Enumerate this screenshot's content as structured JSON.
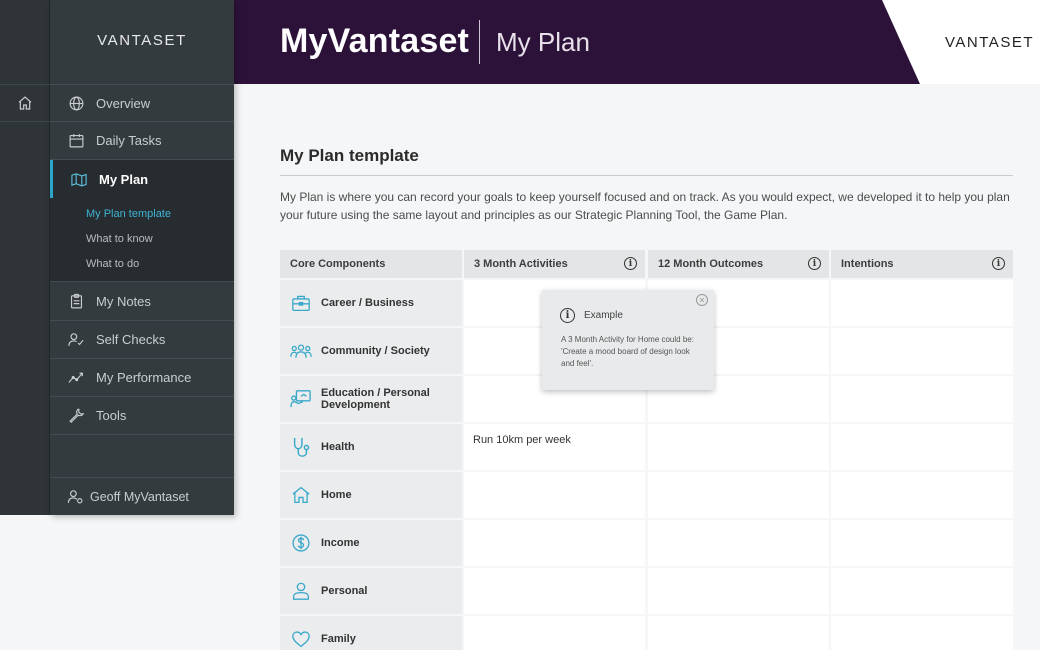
{
  "header": {
    "title": "MyVantaset",
    "subtitle": "My Plan",
    "logo_right": "VANTASET"
  },
  "sidebar": {
    "logo": "VANTASET",
    "items": [
      {
        "label": "Overview",
        "icon": "globe-icon"
      },
      {
        "label": "Daily Tasks",
        "icon": "calendar-icon"
      },
      {
        "label": "My Plan",
        "icon": "map-icon"
      },
      {
        "label": "My Notes",
        "icon": "clipboard-icon"
      },
      {
        "label": "Self Checks",
        "icon": "user-check-icon"
      },
      {
        "label": "My Performance",
        "icon": "trend-icon"
      },
      {
        "label": "Tools",
        "icon": "wrench-icon"
      }
    ],
    "subitems": [
      {
        "label": "My Plan template"
      },
      {
        "label": "What to know"
      },
      {
        "label": "What to do"
      }
    ],
    "user": "Geoff MyVantaset"
  },
  "main": {
    "title": "My Plan template",
    "intro": "My Plan is where you can record your goals to keep yourself focused and on track. As you would expect, we developed it to help you plan your future using the same layout and principles as our Strategic Planning Tool, the Game Plan."
  },
  "table": {
    "columns": [
      "Core Components",
      "3 Month Activities",
      "12 Month Outcomes",
      "Intentions"
    ],
    "rows": [
      {
        "label": "Career / Business",
        "icon": "briefcase-icon",
        "values": [
          "",
          "",
          ""
        ]
      },
      {
        "label": "Community / Society",
        "icon": "people-icon",
        "values": [
          "",
          "",
          ""
        ]
      },
      {
        "label": "Education / Personal Development",
        "icon": "presentation-icon",
        "values": [
          "",
          "",
          ""
        ]
      },
      {
        "label": "Health",
        "icon": "stethoscope-icon",
        "values": [
          "Run 10km per week",
          "",
          ""
        ]
      },
      {
        "label": "Home",
        "icon": "home-icon",
        "values": [
          "",
          "",
          ""
        ]
      },
      {
        "label": "Income",
        "icon": "dollar-icon",
        "values": [
          "",
          "",
          ""
        ]
      },
      {
        "label": "Personal",
        "icon": "person-icon",
        "values": [
          "",
          "",
          ""
        ]
      },
      {
        "label": "Family",
        "icon": "heart-icon",
        "values": [
          "",
          "",
          ""
        ]
      }
    ]
  },
  "tooltip": {
    "title": "Example",
    "body": "A 3 Month Activity for Home could be: 'Create a mood board of design look and feel'."
  },
  "colors": {
    "header_bg": "#2c1238",
    "sidebar_bg": "#343b3f",
    "accent": "#2ca6c8",
    "icon_accent": "#3aa9c9"
  }
}
